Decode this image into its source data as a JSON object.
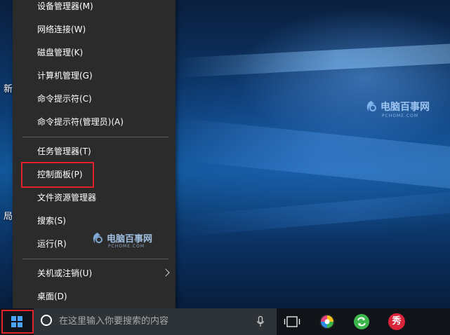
{
  "desktop": {
    "icon_labels": [
      "新",
      "局"
    ],
    "watermark": {
      "text": "电脑百事网",
      "sub": "PCHOME.COM"
    }
  },
  "menu": {
    "items": [
      {
        "label": "设备管理器(M)"
      },
      {
        "label": "网络连接(W)"
      },
      {
        "label": "磁盘管理(K)"
      },
      {
        "label": "计算机管理(G)"
      },
      {
        "label": "命令提示符(C)"
      },
      {
        "label": "命令提示符(管理员)(A)"
      },
      {
        "label": "任务管理器(T)"
      },
      {
        "label": "控制面板(P)"
      },
      {
        "label": "文件资源管理器"
      },
      {
        "label": "搜索(S)"
      },
      {
        "label": "运行(R)"
      },
      {
        "label": "关机或注销(U)"
      },
      {
        "label": "桌面(D)"
      }
    ],
    "watermark": {
      "text": "电脑百事网",
      "sub": "PCHOME.COM"
    }
  },
  "taskbar": {
    "search_placeholder": "在这里输入你要搜索的内容",
    "apps": [
      {
        "icon": "color-wheel-icon",
        "color": "#e0457b"
      },
      {
        "icon": "green-refresh-icon",
        "color": "#3cb64a"
      },
      {
        "icon": "xiu-icon",
        "label": "秀",
        "color": "#d9243a"
      }
    ]
  },
  "colors": {
    "menu_bg": "#2b2b2b",
    "highlight": "#e0222b",
    "taskbar_bg": "#101418",
    "accent": "#4aa3ff"
  }
}
